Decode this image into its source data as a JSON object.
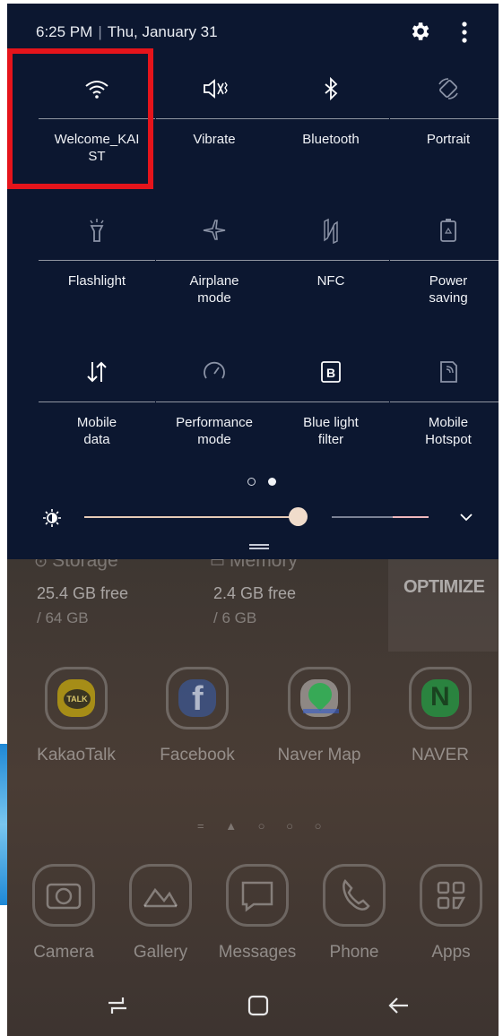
{
  "status_bar": {
    "time": "6:25 PM",
    "date": "Thu, January 31"
  },
  "quick_tiles": [
    {
      "label": "Welcome_KAI\nST",
      "icon": "wifi-icon",
      "state": "on"
    },
    {
      "label": "Vibrate",
      "icon": "vibrate-icon"
    },
    {
      "label": "Bluetooth",
      "icon": "bluetooth-icon"
    },
    {
      "label": "Portrait",
      "icon": "rotation-icon"
    },
    {
      "label": "Flashlight",
      "icon": "flashlight-icon"
    },
    {
      "label": "Airplane\nmode",
      "icon": "airplane-icon"
    },
    {
      "label": "NFC",
      "icon": "nfc-icon"
    },
    {
      "label": "Power\nsaving",
      "icon": "battery-saver-icon"
    },
    {
      "label": "Mobile\ndata",
      "icon": "mobile-data-icon"
    },
    {
      "label": "Performance\nmode",
      "icon": "speedometer-icon"
    },
    {
      "label": "Blue light\nfilter",
      "icon": "blue-light-icon"
    },
    {
      "label": "Mobile\nHotspot",
      "icon": "hotspot-icon"
    }
  ],
  "brightness": {
    "level": 0.62
  },
  "page_indicator": {
    "pages": 2,
    "active": 2
  },
  "background": {
    "storage": {
      "title": "Storage",
      "value": "25.4 GB free",
      "total": "/ 64 GB"
    },
    "memory": {
      "title": "Memory",
      "value": "2.4 GB free",
      "total": "/ 6 GB"
    },
    "optimize_label": "OPTIMIZE",
    "apps_row1": [
      "KakaoTalk",
      "Facebook",
      "Naver Map",
      "NAVER"
    ],
    "apps_row2": [
      "Camera",
      "Gallery",
      "Messages",
      "Phone",
      "Apps"
    ]
  },
  "colors": {
    "panel": "#0c1730",
    "highlight": "#e5141b",
    "kakao": "#f5d100",
    "facebook": "#3b5998",
    "naver": "#19b447"
  }
}
